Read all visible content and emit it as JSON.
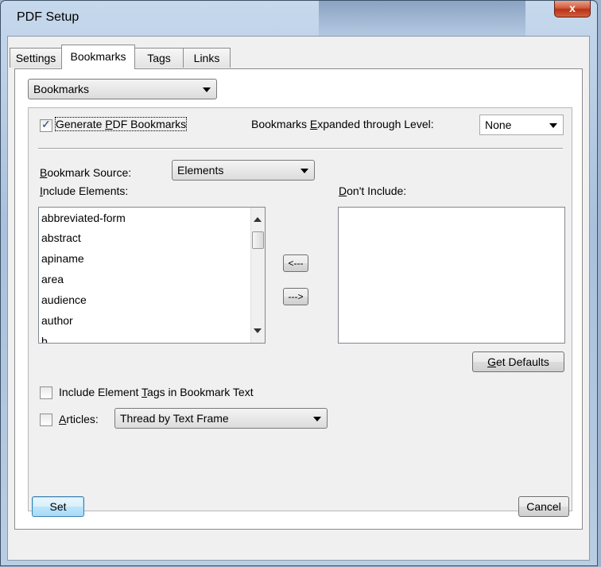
{
  "window": {
    "title": "PDF Setup",
    "close_label": "x"
  },
  "tabs": [
    {
      "label": "Settings"
    },
    {
      "label": "Bookmarks"
    },
    {
      "label": "Tags"
    },
    {
      "label": "Links"
    }
  ],
  "panel_selector": {
    "value": "Bookmarks"
  },
  "generate": {
    "checked": true,
    "label_pre": "Generate ",
    "label_u": "P",
    "label_post": "DF Bookmarks"
  },
  "expanded": {
    "label_pre": "Bookmarks ",
    "label_u": "E",
    "label_post": "xpanded through Level:",
    "value": "None"
  },
  "source": {
    "label_pre": "",
    "label_u": "B",
    "label_post": "ookmark Source:",
    "value": "Elements"
  },
  "include": {
    "label_pre": "",
    "label_u": "I",
    "label_post": "nclude Elements:",
    "items": [
      "abbreviated-form",
      "abstract",
      "apiname",
      "area",
      "audience",
      "author",
      "b"
    ]
  },
  "exclude": {
    "label_pre": "",
    "label_u": "D",
    "label_post": "on't Include:",
    "items": []
  },
  "move_left_label": "<---",
  "move_right_label": "--->",
  "get_defaults": {
    "label_pre": "",
    "label_u": "G",
    "label_post": "et Defaults"
  },
  "include_tags": {
    "checked": false,
    "label_pre": "Include Element ",
    "label_u": "T",
    "label_post": "ags in Bookmark Text"
  },
  "articles": {
    "checked": false,
    "label_pre": "",
    "label_u": "A",
    "label_post": "rticles:",
    "value": "Thread by Text Frame"
  },
  "footer": {
    "set_label": "Set",
    "cancel_label": "Cancel"
  }
}
